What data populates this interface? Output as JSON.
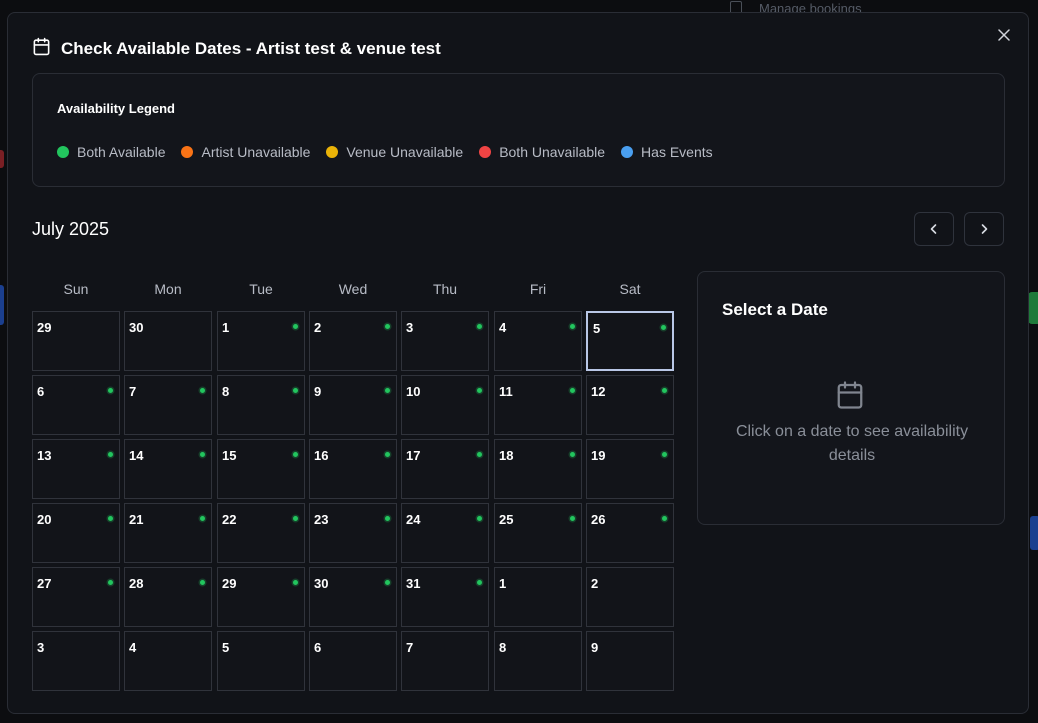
{
  "background": {
    "manage_bookings": "Manage bookings"
  },
  "modal": {
    "title": "Check Available Dates - Artist test & venue test",
    "close_label": "×"
  },
  "legend": {
    "title": "Availability Legend",
    "items": [
      {
        "label": "Both Available",
        "color": "#22c55e"
      },
      {
        "label": "Artist Unavailable",
        "color": "#f97316"
      },
      {
        "label": "Venue Unavailable",
        "color": "#eab308"
      },
      {
        "label": "Both Unavailable",
        "color": "#ef4444"
      },
      {
        "label": "Has Events",
        "color": "#4a9ff0"
      }
    ]
  },
  "calendar": {
    "month_label": "July 2025",
    "weekdays": [
      "Sun",
      "Mon",
      "Tue",
      "Wed",
      "Thu",
      "Fri",
      "Sat"
    ],
    "days": [
      {
        "n": "29",
        "avail": false
      },
      {
        "n": "30",
        "avail": false
      },
      {
        "n": "1",
        "avail": true
      },
      {
        "n": "2",
        "avail": true
      },
      {
        "n": "3",
        "avail": true
      },
      {
        "n": "4",
        "avail": true
      },
      {
        "n": "5",
        "avail": true,
        "selected": true
      },
      {
        "n": "6",
        "avail": true
      },
      {
        "n": "7",
        "avail": true
      },
      {
        "n": "8",
        "avail": true
      },
      {
        "n": "9",
        "avail": true
      },
      {
        "n": "10",
        "avail": true
      },
      {
        "n": "11",
        "avail": true
      },
      {
        "n": "12",
        "avail": true
      },
      {
        "n": "13",
        "avail": true
      },
      {
        "n": "14",
        "avail": true
      },
      {
        "n": "15",
        "avail": true
      },
      {
        "n": "16",
        "avail": true
      },
      {
        "n": "17",
        "avail": true
      },
      {
        "n": "18",
        "avail": true
      },
      {
        "n": "19",
        "avail": true
      },
      {
        "n": "20",
        "avail": true
      },
      {
        "n": "21",
        "avail": true
      },
      {
        "n": "22",
        "avail": true
      },
      {
        "n": "23",
        "avail": true
      },
      {
        "n": "24",
        "avail": true
      },
      {
        "n": "25",
        "avail": true
      },
      {
        "n": "26",
        "avail": true
      },
      {
        "n": "27",
        "avail": true
      },
      {
        "n": "28",
        "avail": true
      },
      {
        "n": "29",
        "avail": true
      },
      {
        "n": "30",
        "avail": true
      },
      {
        "n": "31",
        "avail": true
      },
      {
        "n": "1",
        "avail": false
      },
      {
        "n": "2",
        "avail": false
      },
      {
        "n": "3",
        "avail": false
      },
      {
        "n": "4",
        "avail": false
      },
      {
        "n": "5",
        "avail": false
      },
      {
        "n": "6",
        "avail": false
      },
      {
        "n": "7",
        "avail": false
      },
      {
        "n": "8",
        "avail": false
      },
      {
        "n": "9",
        "avail": false
      }
    ]
  },
  "detail": {
    "title": "Select a Date",
    "hint": "Click on a date to see availability details"
  }
}
